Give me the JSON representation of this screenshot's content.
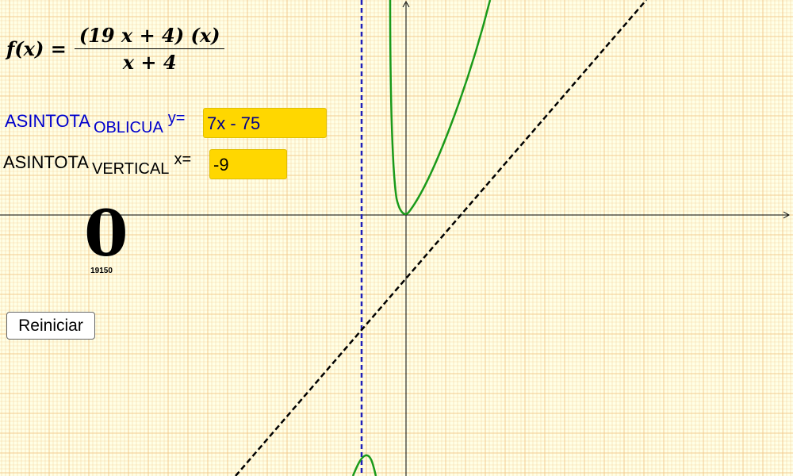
{
  "formula": {
    "lhs": "f(x) =",
    "numerator": "(19 x + 4) (x)",
    "denominator": "x + 4"
  },
  "oblique": {
    "title": "ASINTOTA",
    "subscript": "OBLICUA",
    "eq_label": "y=",
    "value": "7x - 75"
  },
  "vertical": {
    "title": "ASINTOTA",
    "subscript": "VERTICAL",
    "eq_label": "x=",
    "value": "-9"
  },
  "score": "0",
  "code": "19150",
  "reset_label": "Reiniciar",
  "colors": {
    "background": "#ffffe6",
    "grid": "#f2c78a",
    "curve": "#1a9a1a",
    "vertical_asymptote": "#1f1fbb",
    "oblique_asymptote": "#000000",
    "highlight": "#ffd700",
    "oblique_text": "#0000cc"
  },
  "icons": {
    "y_axis_arrow": "arrow-up-icon",
    "x_axis_arrow": "arrow-right-icon"
  }
}
